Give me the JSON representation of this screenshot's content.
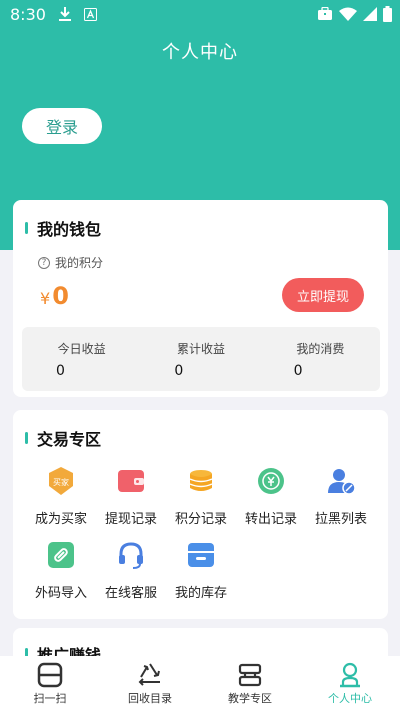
{
  "status_bar": {
    "time": "8:30"
  },
  "header": {
    "title": "个人中心",
    "login_label": "登录"
  },
  "wallet": {
    "title": "我的钱包",
    "points_label": "我的积分",
    "currency": "¥",
    "balance": "0",
    "withdraw_label": "立即提现",
    "stats": [
      {
        "label": "今日收益",
        "value": "0"
      },
      {
        "label": "累计收益",
        "value": "0"
      },
      {
        "label": "我的消费",
        "value": "0"
      }
    ]
  },
  "trade": {
    "title": "交易专区",
    "badge_text": "买家",
    "items": [
      {
        "label": "成为买家",
        "icon": "buyer-badge-icon"
      },
      {
        "label": "提现记录",
        "icon": "wallet-icon"
      },
      {
        "label": "积分记录",
        "icon": "coins-icon"
      },
      {
        "label": "转出记录",
        "icon": "yuan-transfer-icon"
      },
      {
        "label": "拉黑列表",
        "icon": "block-user-icon"
      },
      {
        "label": "外码导入",
        "icon": "link-import-icon"
      },
      {
        "label": "在线客服",
        "icon": "headset-icon"
      },
      {
        "label": "我的库存",
        "icon": "inventory-box-icon"
      }
    ]
  },
  "promo": {
    "title": "推广赚钱"
  },
  "bottom_nav": [
    {
      "label": "扫一扫",
      "icon": "scan-icon"
    },
    {
      "label": "回收目录",
      "icon": "recycle-icon"
    },
    {
      "label": "教学专区",
      "icon": "teaching-icon"
    },
    {
      "label": "个人中心",
      "icon": "profile-icon"
    }
  ],
  "colors": {
    "primary": "#2dbda8",
    "accent_red": "#f25c5c",
    "balance_orange": "#f28b2f"
  }
}
